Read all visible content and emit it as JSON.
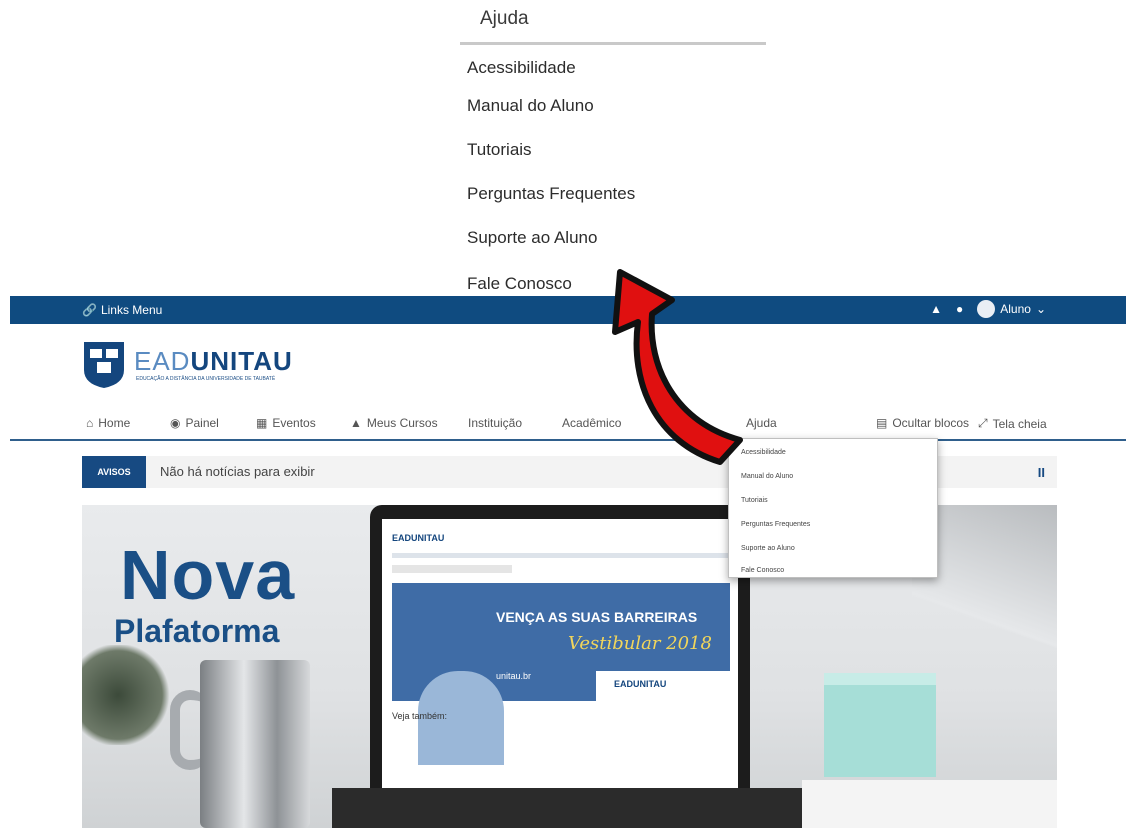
{
  "zoom_menu": {
    "title": "Ajuda",
    "items": [
      "Acessibilidade",
      "Manual do Aluno",
      "Tutoriais",
      "Perguntas Frequentes",
      "Suporte ao Aluno",
      "Fale Conosco"
    ]
  },
  "topbar": {
    "links_menu": "Links Menu",
    "user_label": "Aluno",
    "icons": [
      "link-icon",
      "bell-icon",
      "chat-icon",
      "user-avatar-icon",
      "caret-down-icon"
    ]
  },
  "brand": {
    "ead": "EAD",
    "unitau": "UNITAU",
    "subtitle": "EDUCAÇÃO A DISTÂNCIA DA UNIVERSIDADE DE TAUBATÉ"
  },
  "nav": {
    "items": [
      {
        "label": "Home",
        "icon": "home-icon"
      },
      {
        "label": "Painel",
        "icon": "dashboard-icon"
      },
      {
        "label": "Eventos",
        "icon": "calendar-icon"
      },
      {
        "label": "Meus Cursos",
        "icon": "graduation-cap-icon"
      },
      {
        "label": "Instituição",
        "icon": ""
      },
      {
        "label": "Acadêmico",
        "icon": ""
      },
      {
        "label": "Ajuda",
        "icon": ""
      }
    ],
    "hide_blocks": "Ocultar blocos",
    "fullscreen": "Tela cheia"
  },
  "avisos": {
    "badge": "AVISOS",
    "text": "Não há notícias para exibir",
    "pause": "II"
  },
  "hero": {
    "title": "Nova",
    "subtitle": "Plafatorma",
    "screen": {
      "logo": "EADUNITAU",
      "banner_line1": "VENÇA AS SUAS BARREIRAS",
      "banner_line2": "Vestibular 2018",
      "banner_cta": "unitau.br",
      "banner_logo": "EADUNITAU",
      "see_also": "Veja também:"
    }
  },
  "dropdown": {
    "items": [
      "Acessibilidade",
      "Manual do Aluno",
      "Tutoriais",
      "Perguntas Frequentes",
      "Suporte ao Aluno",
      "Fale Conosco"
    ]
  },
  "colors": {
    "brand_blue": "#0f4b80",
    "arrow_red": "#e01010"
  }
}
